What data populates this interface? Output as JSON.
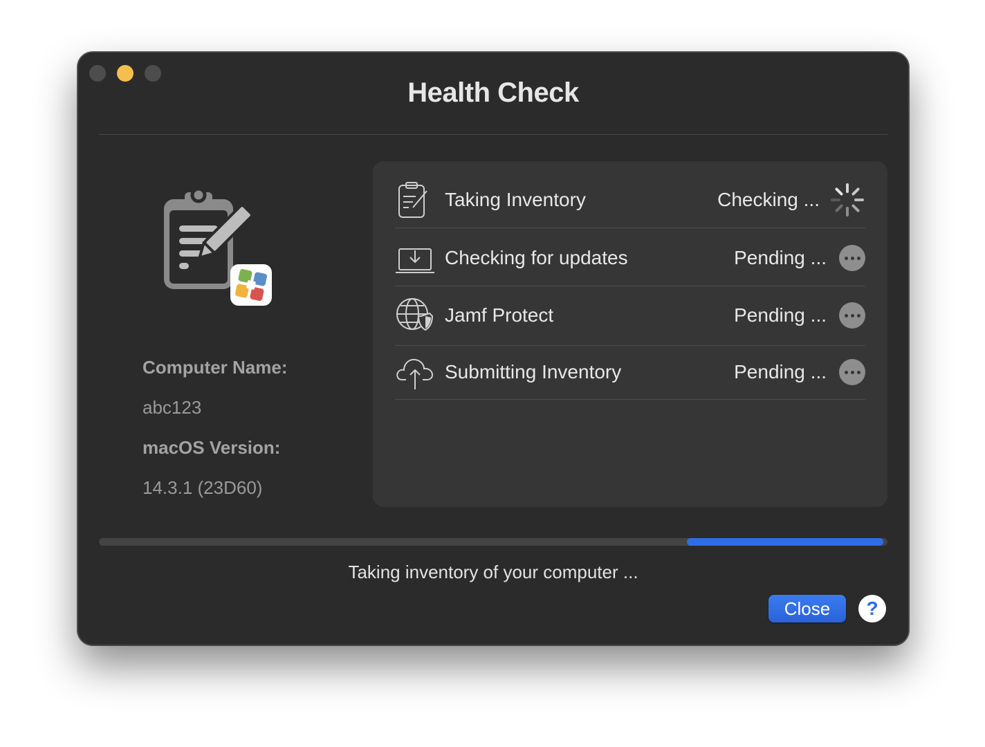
{
  "window": {
    "title": "Health Check",
    "traffic_lights": [
      "close-disabled",
      "minimize",
      "zoom-disabled"
    ]
  },
  "device": {
    "computer_name_label": "Computer Name:",
    "computer_name": "abc123",
    "macos_version_label": "macOS Version:",
    "macos_version": "14.3.1 (23D60)"
  },
  "tasks": [
    {
      "icon": "clipboard-edit-icon",
      "label": "Taking Inventory",
      "status": "Checking ...",
      "status_icon": "spinner-icon"
    },
    {
      "icon": "laptop-download-icon",
      "label": "Checking for updates",
      "status": "Pending ...",
      "status_icon": "ellipsis-icon"
    },
    {
      "icon": "globe-shield-icon",
      "label": "Jamf Protect",
      "status": "Pending ...",
      "status_icon": "ellipsis-icon"
    },
    {
      "icon": "cloud-upload-icon",
      "label": "Submitting Inventory",
      "status": "Pending ...",
      "status_icon": "ellipsis-icon"
    }
  ],
  "progress": {
    "message": "Taking inventory of your computer ...",
    "accent_color": "#2f6de6"
  },
  "buttons": {
    "close_label": "Close",
    "help_label": "?"
  }
}
